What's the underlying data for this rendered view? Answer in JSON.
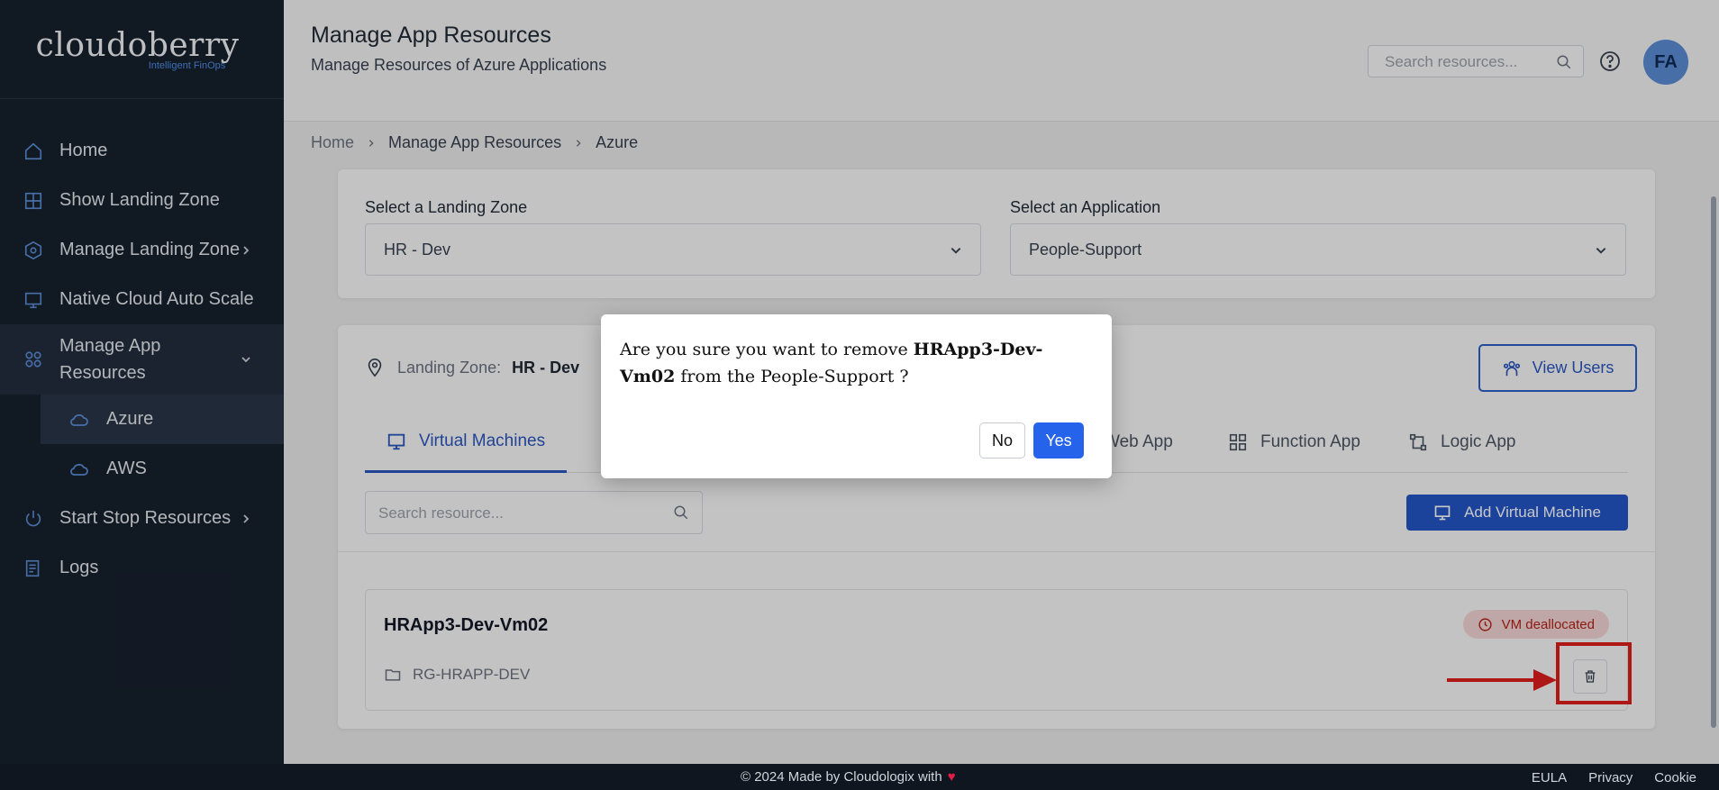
{
  "sidebar": {
    "logo": {
      "main": "cloudoberry",
      "tagline": "Intelligent FinOps"
    },
    "items": [
      {
        "label": "Home",
        "icon": "home-icon"
      },
      {
        "label": "Show Landing Zone",
        "icon": "grid-icon"
      },
      {
        "label": "Manage Landing Zone",
        "icon": "hexagon-icon"
      },
      {
        "label": "Native Cloud Auto Scale",
        "icon": "monitor-icon"
      },
      {
        "label": "Manage App Resources",
        "icon": "apps-icon"
      },
      {
        "label": "Start Stop Resources",
        "icon": "power-icon"
      },
      {
        "label": "Logs",
        "icon": "document-icon"
      }
    ],
    "sub_items": [
      {
        "label": "Azure",
        "icon": "cloud-icon"
      },
      {
        "label": "AWS",
        "icon": "cloud-icon"
      }
    ]
  },
  "header": {
    "title": "Manage App Resources",
    "subtitle": "Manage Resources of Azure Applications",
    "search_placeholder": "Search resources...",
    "avatar_initials": "FA"
  },
  "breadcrumb": [
    "Home",
    "Manage App Resources",
    "Azure"
  ],
  "selectors": {
    "landing_zone_label": "Select a Landing Zone",
    "landing_zone_value": "HR - Dev",
    "application_label": "Select an Application",
    "application_value": "People-Support"
  },
  "summary": {
    "landing_zone_label": "Landing Zone:",
    "landing_zone_value": "HR - Dev",
    "view_users": "View Users"
  },
  "tabs": [
    {
      "label": "Virtual Machines",
      "active": true
    },
    {
      "label": "Web App"
    },
    {
      "label": "Function App"
    },
    {
      "label": "Logic App"
    }
  ],
  "resources": {
    "search_placeholder": "Search resource...",
    "add_button": "Add Virtual Machine",
    "vm": {
      "name": "HRApp3-Dev-Vm02",
      "resource_group": "RG-HRAPP-DEV",
      "status": "VM deallocated"
    }
  },
  "modal": {
    "text_before": "Are you sure you want to remove ",
    "resource": "HRApp3-Dev-Vm02",
    "text_after": " from the People-Support ?",
    "no": "No",
    "yes": "Yes"
  },
  "footer": {
    "copyright": "© 2024 Made by Cloudologix with",
    "heart": "♥",
    "links": [
      "EULA",
      "Privacy",
      "Cookie"
    ]
  },
  "colors": {
    "sidebar_bg": "#17202e",
    "accent": "#2557c8",
    "danger": "#e11d1d",
    "badge_bg": "#f6d7d7"
  }
}
